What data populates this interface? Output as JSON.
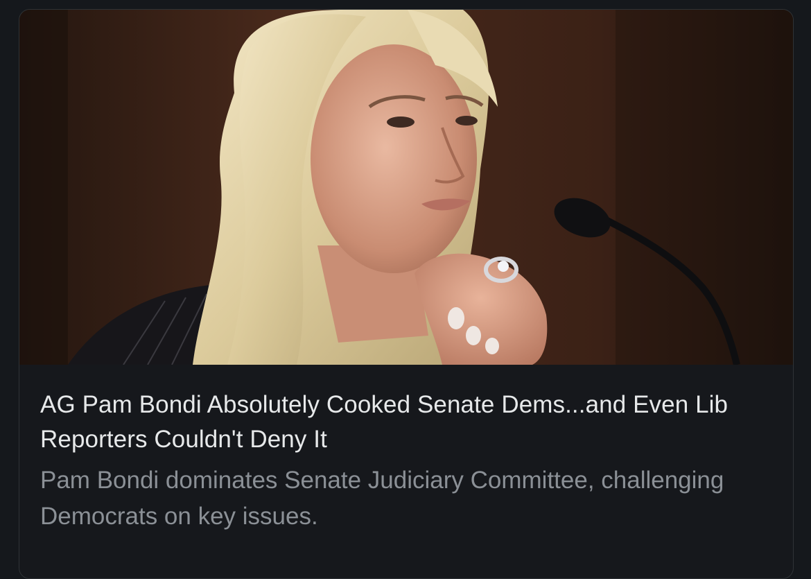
{
  "card": {
    "image_alt": "Pam Bondi at a Senate hearing, hand on chin, microphone in front",
    "headline": "AG Pam Bondi Absolutely Cooked Senate Dems...and Even Lib Reporters Couldn't Deny It",
    "summary": "Pam Bondi dominates Senate Judiciary Committee, challenging Democrats on key issues."
  },
  "colors": {
    "page_background": "#15181c",
    "card_background": "#16181c",
    "card_border": "#2f3336",
    "headline_text": "#e7e9ea",
    "summary_text": "#8b9096"
  }
}
